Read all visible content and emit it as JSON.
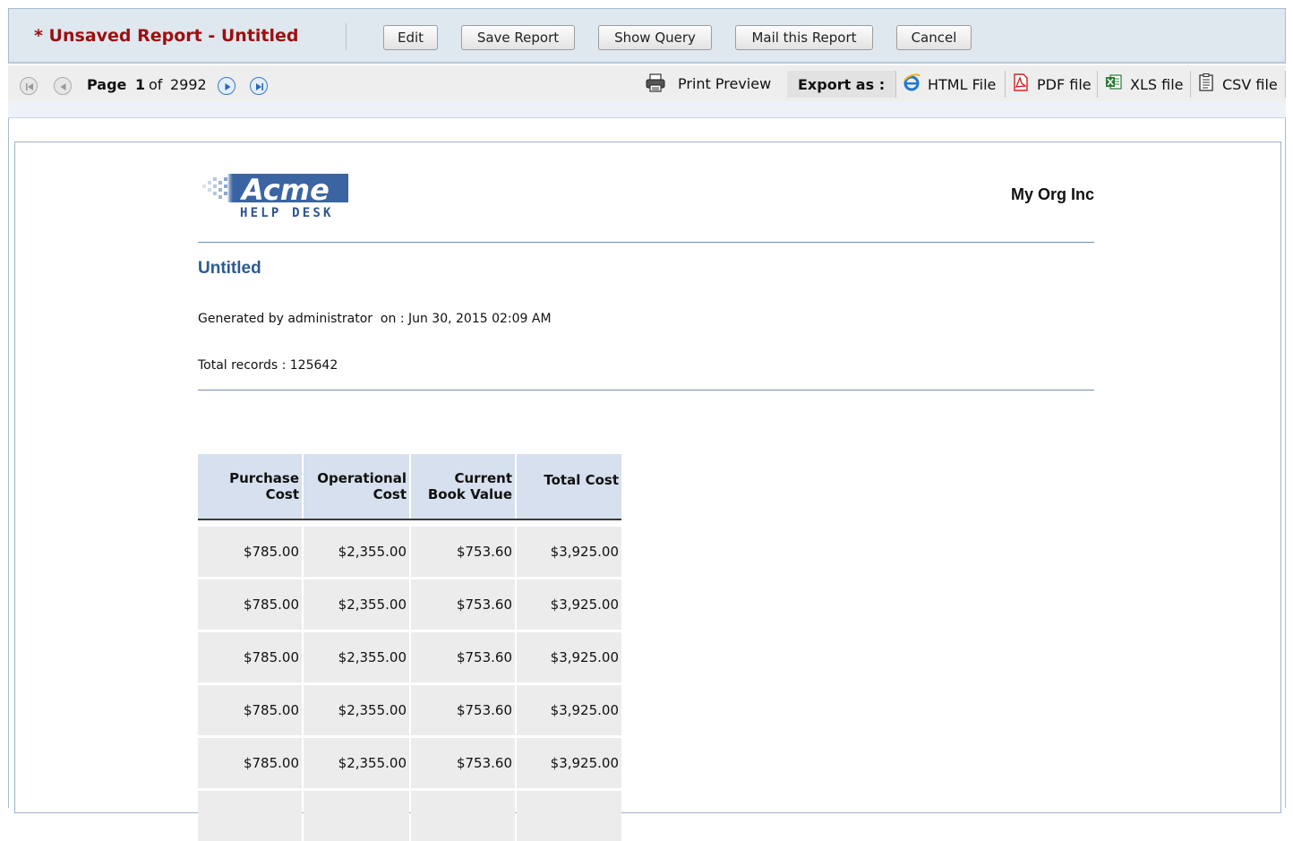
{
  "header": {
    "title": "* Unsaved Report - Untitled",
    "buttons": {
      "edit": "Edit",
      "save": "Save Report",
      "show_query": "Show Query",
      "mail": "Mail this Report",
      "cancel": "Cancel"
    }
  },
  "pagination": {
    "label": "Page",
    "current": "1",
    "of": "of",
    "total": "2992",
    "icons": [
      "first-page-icon",
      "previous-page-icon",
      "next-page-icon",
      "last-page-icon"
    ]
  },
  "toolbar": {
    "print_preview": "Print Preview",
    "export_label": "Export as :",
    "exports": {
      "html": "HTML File",
      "pdf": "PDF file",
      "xls": "XLS file",
      "csv": "CSV file"
    }
  },
  "report": {
    "logo_text": "Acme",
    "logo_subtext": "HELP DESK",
    "org_name": "My Org Inc",
    "title": "Untitled",
    "generated_line": "Generated by administrator  on : Jun 30, 2015 02:09 AM",
    "total_records_line": "Total records : 125642",
    "columns": [
      [
        "Purchase",
        "Cost"
      ],
      [
        "Operational",
        "Cost"
      ],
      [
        "Current",
        "Book Value"
      ],
      [
        "Total Cost",
        ""
      ]
    ],
    "rows": [
      [
        "$785.00",
        "$2,355.00",
        "$753.60",
        "$3,925.00"
      ],
      [
        "$785.00",
        "$2,355.00",
        "$753.60",
        "$3,925.00"
      ],
      [
        "$785.00",
        "$2,355.00",
        "$753.60",
        "$3,925.00"
      ],
      [
        "$785.00",
        "$2,355.00",
        "$753.60",
        "$3,925.00"
      ],
      [
        "$785.00",
        "$2,355.00",
        "$753.60",
        "$3,925.00"
      ],
      [
        "",
        "",
        "",
        ""
      ]
    ]
  },
  "colors": {
    "title_red": "#9c0f0f",
    "header_bg": "#dfe7ef",
    "report_title_blue": "#2c5a94",
    "table_header_bg": "#d6e0ee",
    "table_cell_bg": "#ececec"
  }
}
